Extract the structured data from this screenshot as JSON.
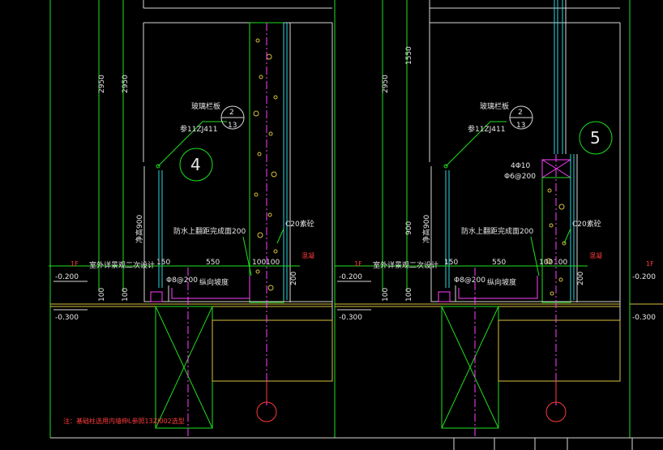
{
  "details": [
    {
      "detail_no": "4",
      "ref_top": "2",
      "ref_bottom": "13",
      "note_glass": "玻璃栏板",
      "note_ref": "参11ZJ411",
      "net_height": "净高900",
      "dim_2950_a": "2950",
      "dim_2950_b": "2950",
      "dim_150": "150",
      "dim_550": "550",
      "dim_100a": "100",
      "dim_100b": "100",
      "dim_200": "200",
      "dim_100_left": "100",
      "dim_100_left2": "100",
      "level_1f": "1F",
      "level_a": "-0.200",
      "level_b": "-0.300",
      "outdoor": "室外详景观二次设计",
      "waterproof": "防水上翻距完成面200",
      "concrete": "C20素砼",
      "rebar": "Φ8@200",
      "label_red": "混凝",
      "label_drain": "纵向坡度",
      "note": "注：基础柱选用内墙伸L参照13ZJ002选型"
    },
    {
      "detail_no": "5",
      "ref_top": "2",
      "ref_bottom": "13",
      "note_glass": "玻璃栏板",
      "note_ref": "参11ZJ411",
      "net_height": "净高900",
      "dim_1550": "1550",
      "dim_2950": "2950",
      "dim_900": "900",
      "dim_150": "150",
      "dim_550": "550",
      "dim_100a": "100",
      "dim_100b": "100",
      "dim_200": "200",
      "dim_100_left": "100",
      "dim_100_left2": "100",
      "level_1f": "1F",
      "level_a": "-0.200",
      "level_b": "-0.300",
      "outdoor": "室外详景观二次设计",
      "waterproof": "防水上翻距完成面200",
      "concrete": "C20素砼",
      "rebar": "Φ8@200",
      "rebar_top1": "4Φ10",
      "rebar_top2": "Φ6@200",
      "label_red": "混凝",
      "label_drain": "纵向坡度"
    }
  ],
  "right_edge": {
    "level_1f": "1F",
    "level_a": "-0.200",
    "level_b": "-0.300"
  },
  "colors": {
    "background": "#000000",
    "green": "#1fe01f",
    "white": "#e8e8e8",
    "cyan": "#2bd9e0",
    "yellow": "#d8c040",
    "red": "#ff3b3b",
    "magenta": "#ff40ff"
  }
}
